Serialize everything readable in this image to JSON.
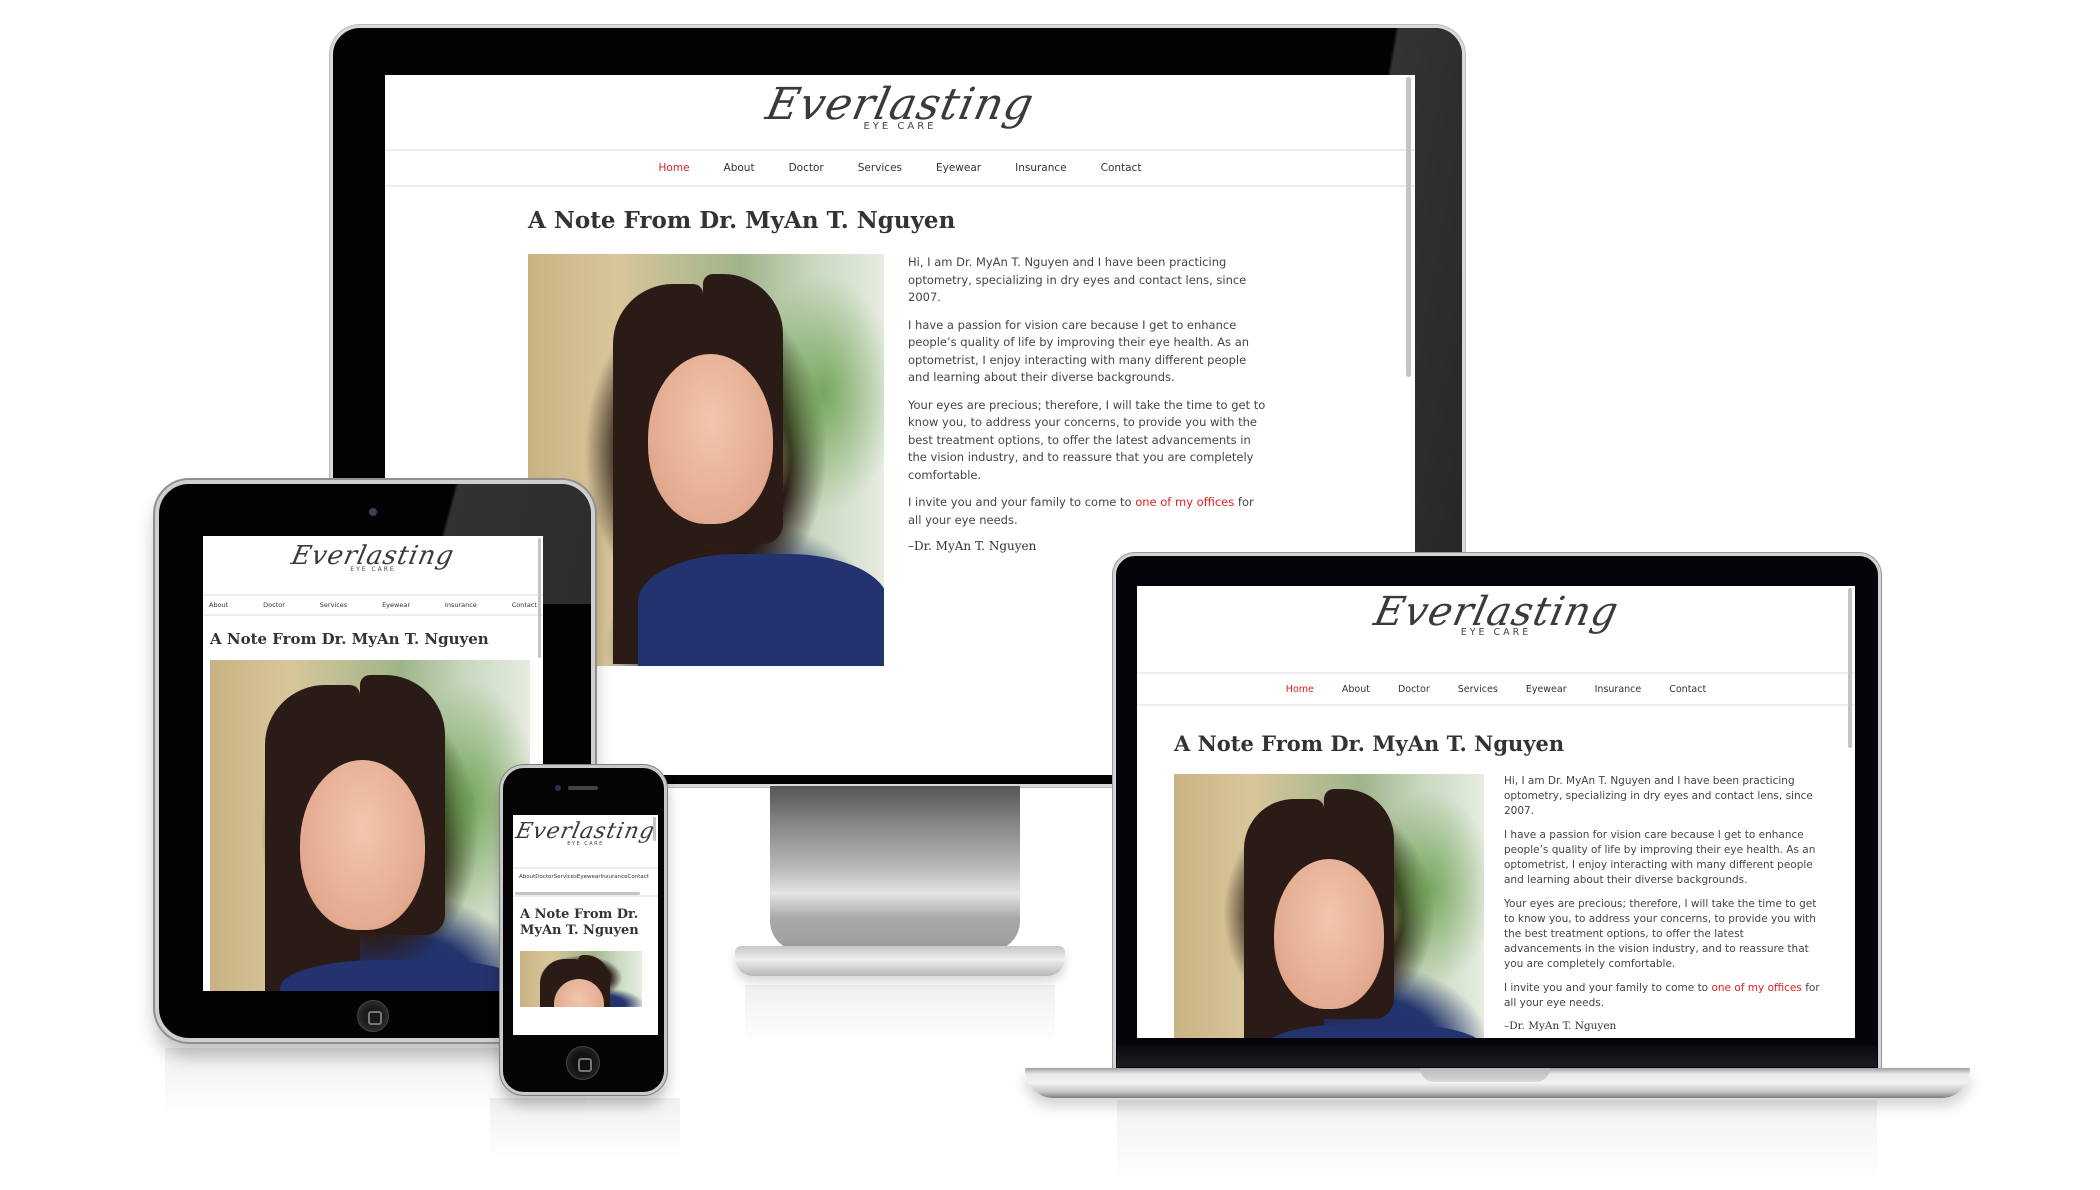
{
  "site": {
    "logo_script": "Everlasting",
    "logo_sub": "EYE CARE",
    "nav": [
      {
        "label": "Home",
        "active": true
      },
      {
        "label": "About",
        "active": false
      },
      {
        "label": "Doctor",
        "active": false
      },
      {
        "label": "Services",
        "active": false
      },
      {
        "label": "Eyewear",
        "active": false
      },
      {
        "label": "Insurance",
        "active": false
      },
      {
        "label": "Contact",
        "active": false
      }
    ],
    "heading": "A Note From Dr. MyAn T. Nguyen",
    "heading_phone_line1": "A Note From Dr.",
    "heading_phone_line2": "MyAn T. Nguyen",
    "photo_alt": "Portrait of Dr. MyAn T. Nguyen",
    "paragraphs": [
      "Hi, I am Dr. MyAn T. Nguyen and I have been practicing optometry, specializing in dry eyes and contact lens, since 2007.",
      "I have a passion for vision care because I get to enhance people’s quality of life by improving their eye health. As an optometrist, I enjoy interacting with many different people and learning about their diverse backgrounds.",
      "Your eyes are precious; therefore, I will take the time to get to know you, to address your concerns, to provide you with the best treatment options, to offer the latest advancements in the vision industry, and to reassure that you are completely comfortable."
    ],
    "invite_before": "I invite you and your family to come to ",
    "invite_link": "one of my offices",
    "invite_after": " for all your eye needs.",
    "signature": "–Dr. MyAn T. Nguyen"
  },
  "colors": {
    "accent": "#e02020",
    "text": "#333333",
    "bezel": "#020202"
  },
  "devices": [
    "monitor",
    "tablet",
    "phone",
    "laptop"
  ]
}
